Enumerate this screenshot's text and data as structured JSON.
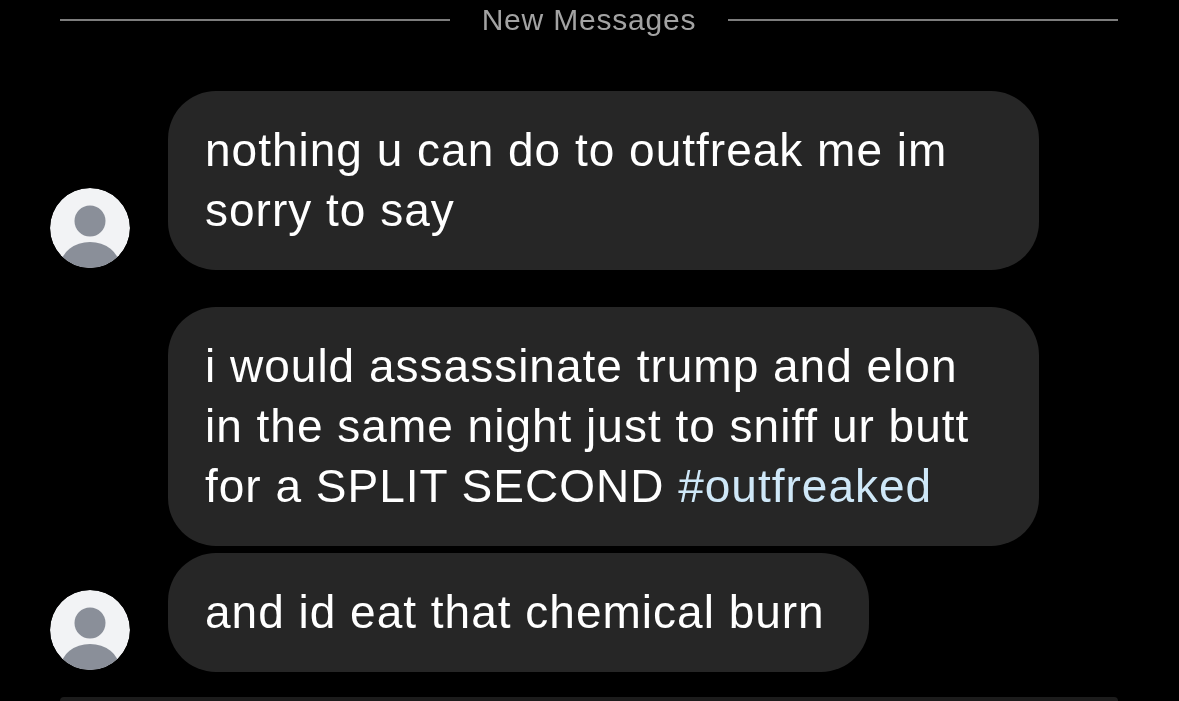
{
  "divider": {
    "label": "New Messages"
  },
  "messages": [
    {
      "text": "nothing u can do to outfreak me im sorry to say",
      "avatar": true
    },
    {
      "text": "i would assassinate trump and elon in the same night just to sniff ur butt for a SPLIT SECOND",
      "hashtag": "#outfreaked",
      "avatar": false
    },
    {
      "text": "and id eat that chemical burn",
      "avatar": true
    }
  ]
}
